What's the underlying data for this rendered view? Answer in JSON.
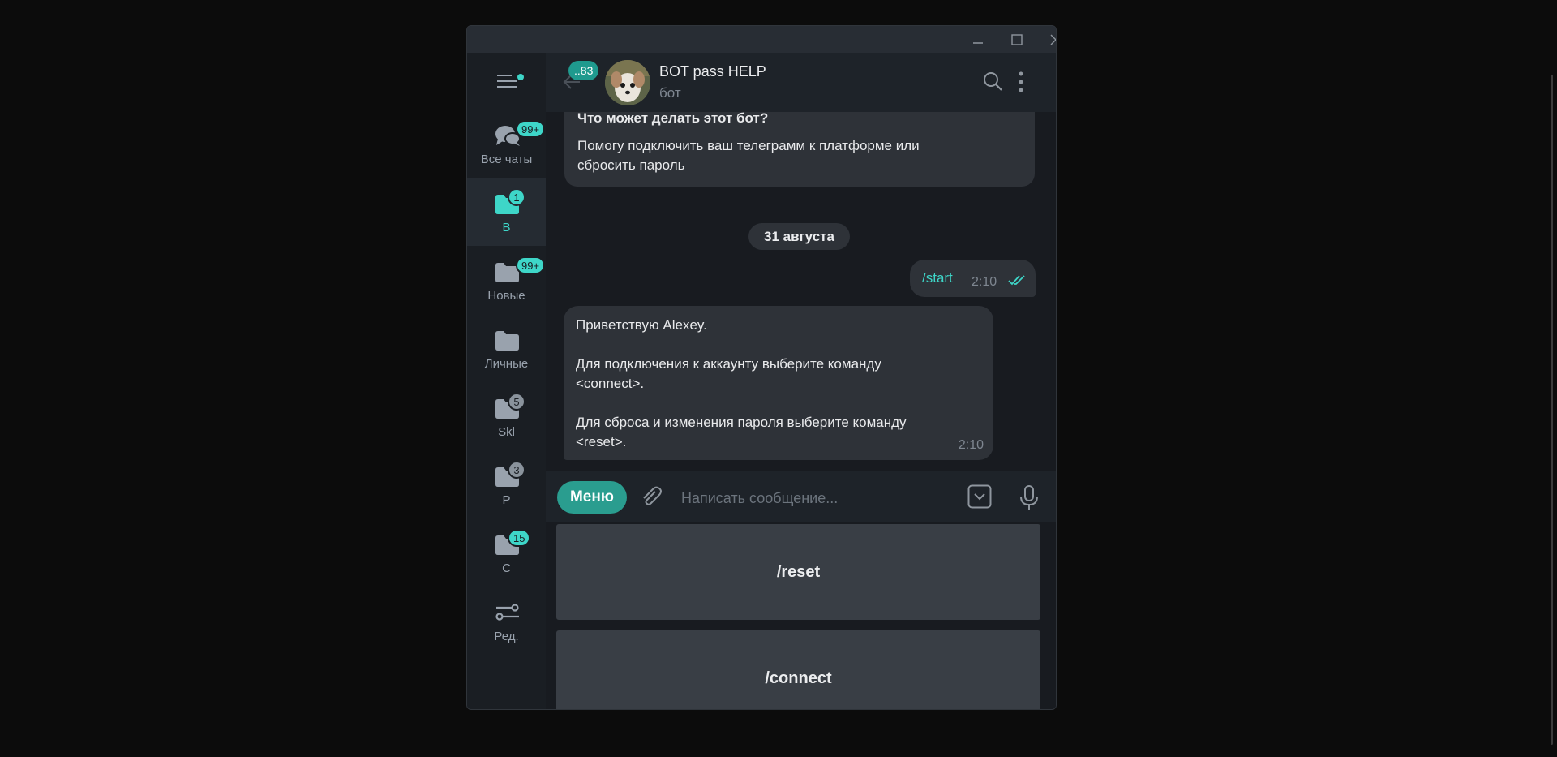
{
  "window": {
    "controls": {
      "minimize_icon": "minimize-icon",
      "maximize_icon": "maximize-icon",
      "close_icon": "close-icon"
    }
  },
  "sidebar": {
    "menu_icon": "hamburger-icon",
    "folders": [
      {
        "label": "Все чаты",
        "badge": "99+",
        "icon": "chats-icon",
        "active": false
      },
      {
        "label": "В",
        "badge": "1",
        "icon": "folder-icon",
        "active": true
      },
      {
        "label": "Новые",
        "badge": "99+",
        "icon": "folder-icon",
        "active": false
      },
      {
        "label": "Личные",
        "badge": "",
        "icon": "folder-icon",
        "active": false
      },
      {
        "label": "Skl",
        "badge": "5",
        "icon": "folder-icon",
        "active": false
      },
      {
        "label": "P",
        "badge": "3",
        "icon": "folder-icon",
        "active": false
      },
      {
        "label": "C",
        "badge": "15",
        "icon": "folder-icon",
        "active": false
      },
      {
        "label": "Ред.",
        "badge": "",
        "icon": "sliders-icon",
        "active": false
      }
    ]
  },
  "header": {
    "unread": "..83",
    "title": "BOT pass HELP",
    "status": "бот"
  },
  "messages": {
    "intro_question": "Что может делать этот бот?",
    "intro_line1": "Помогу подключить ваш телеграмм к платформе или",
    "intro_line2": "сбросить пароль",
    "date": "31 августа",
    "outgoing": {
      "text": "/start",
      "time": "2:10"
    },
    "incoming": {
      "line1": "Приветствую Alexey.",
      "line2": "Для подключения к аккаунту выберите команду",
      "line3": "<connect>.",
      "line4": "Для сброса и изменения пароля выберите команду",
      "line5": "<reset>.",
      "time": "2:10"
    }
  },
  "composer": {
    "menu_label": "Меню",
    "placeholder": "Написать сообщение..."
  },
  "keyboard": {
    "buttons": [
      "/reset",
      "/connect"
    ]
  },
  "colors": {
    "accent": "#3ed6c8",
    "menu_button": "#2a9d8f",
    "bubble": "#2e3238",
    "background": "#181b20"
  }
}
